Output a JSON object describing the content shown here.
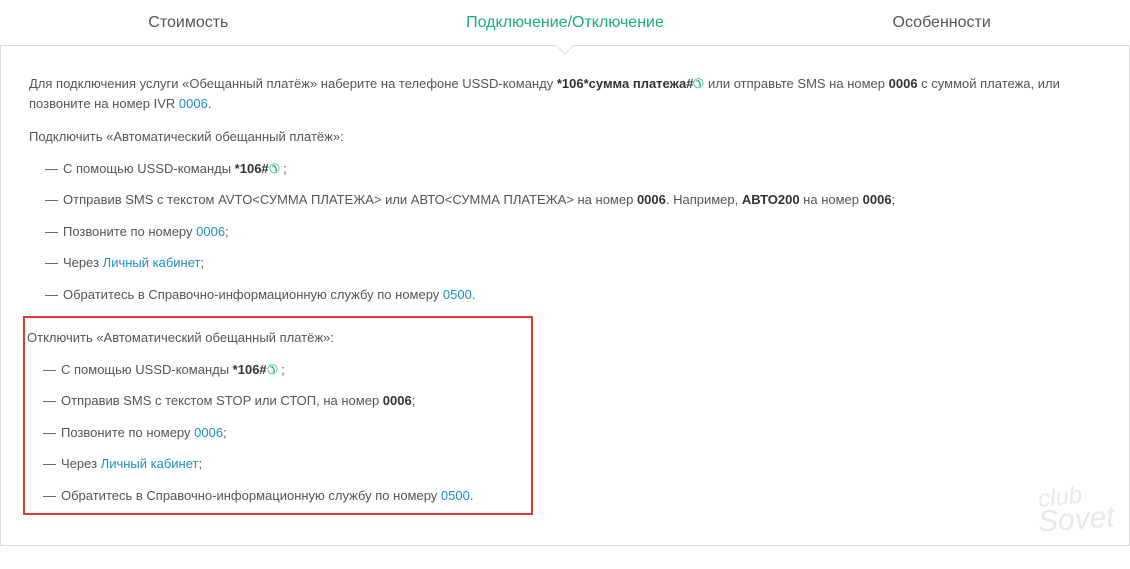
{
  "tabs": {
    "cost": "Стоимость",
    "connect": "Подключение/Отключение",
    "features": "Особенности"
  },
  "intro": {
    "p1_a": "Для подключения услуги «Обещанный платёж» наберите на телефоне USSD-команду ",
    "ussd_full": " *106*сумма платежа#",
    "p1_b": "  или отправьте SMS на номер ",
    "sms_num": "0006",
    "p1_c": " с суммой платежа, или позвоните на номер IVR ",
    "ivr_num": "0006",
    "p1_d": "."
  },
  "connect": {
    "heading": "Подключить «Автоматический обещанный платёж»:",
    "items": {
      "0": {
        "a": "С помощью USSD-команды ",
        "code": " *106#",
        "b": "  ;"
      },
      "1": {
        "a": "Отправив SMS с текстом AVTO<СУММА ПЛАТЕЖА> или АВТО<СУММА ПЛАТЕЖА> на номер ",
        "num1": "0006",
        "b": ". Например, ",
        "ex": "АВТО200",
        "c": " на номер ",
        "num2": "0006",
        "d": ";"
      },
      "2": {
        "a": "Позвоните по номеру ",
        "link": "0006",
        "b": ";"
      },
      "3": {
        "a": "Через ",
        "link": "Личный кабинет",
        "b": ";"
      },
      "4": {
        "a": "Обратитесь в Справочно-информационную службу по номеру ",
        "link": "0500",
        "b": "."
      }
    }
  },
  "disconnect": {
    "heading": "Отключить «Автоматический обещанный платёж»:",
    "items": {
      "0": {
        "a": "С помощью USSD-команды ",
        "code": " *106#",
        "b": "  ;"
      },
      "1": {
        "a": "Отправив SMS с текстом STOP или СТОП, на номер ",
        "num": "0006",
        "b": ";"
      },
      "2": {
        "a": "Позвоните по номеру ",
        "link": "0006",
        "b": ";"
      },
      "3": {
        "a": "Через ",
        "link": "Личный кабинет",
        "b": ";"
      },
      "4": {
        "a": "Обратитесь в Справочно-информационную службу по номеру ",
        "link": "0500",
        "b": "."
      }
    }
  },
  "watermark": {
    "line1": "club",
    "line2": "Sovet"
  },
  "icons": {
    "phone": "✆"
  },
  "dash": "—"
}
